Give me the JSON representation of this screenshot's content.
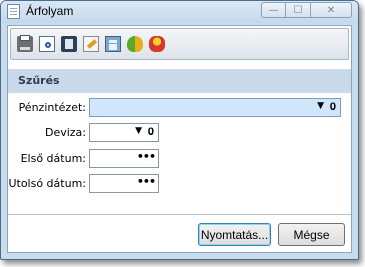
{
  "window": {
    "title": "Árfolyam",
    "controls": {
      "minimize": "—",
      "maximize": "☐",
      "close": "✕"
    }
  },
  "toolbar": {
    "buttons": [
      {
        "icon": "printer-icon"
      },
      {
        "icon": "print-preview-icon"
      },
      {
        "icon": "copy-icon"
      },
      {
        "icon": "edit-icon"
      },
      {
        "icon": "calculator-icon"
      },
      {
        "icon": "coins-icon"
      },
      {
        "icon": "currency-icon"
      }
    ]
  },
  "filter": {
    "section_title": "Szűrés",
    "fields": {
      "institution": {
        "label": "Pénzintézet:",
        "value": ""
      },
      "currency": {
        "label": "Deviza:",
        "value": ""
      },
      "first_date": {
        "label": "Első dátum:",
        "value": ""
      },
      "last_date": {
        "label": "Utolsó dátum:",
        "value": ""
      }
    },
    "glyphs": {
      "dropdown": "▼",
      "clip": "𝟎",
      "ellipsis": "•••"
    }
  },
  "buttons": {
    "print": "Nyomtatás...",
    "cancel": "Mégse"
  },
  "colors": {
    "titlebar": "#c4d8ec",
    "section_header": "#c9d9ea",
    "highlight_field": "#cfe6fb"
  }
}
